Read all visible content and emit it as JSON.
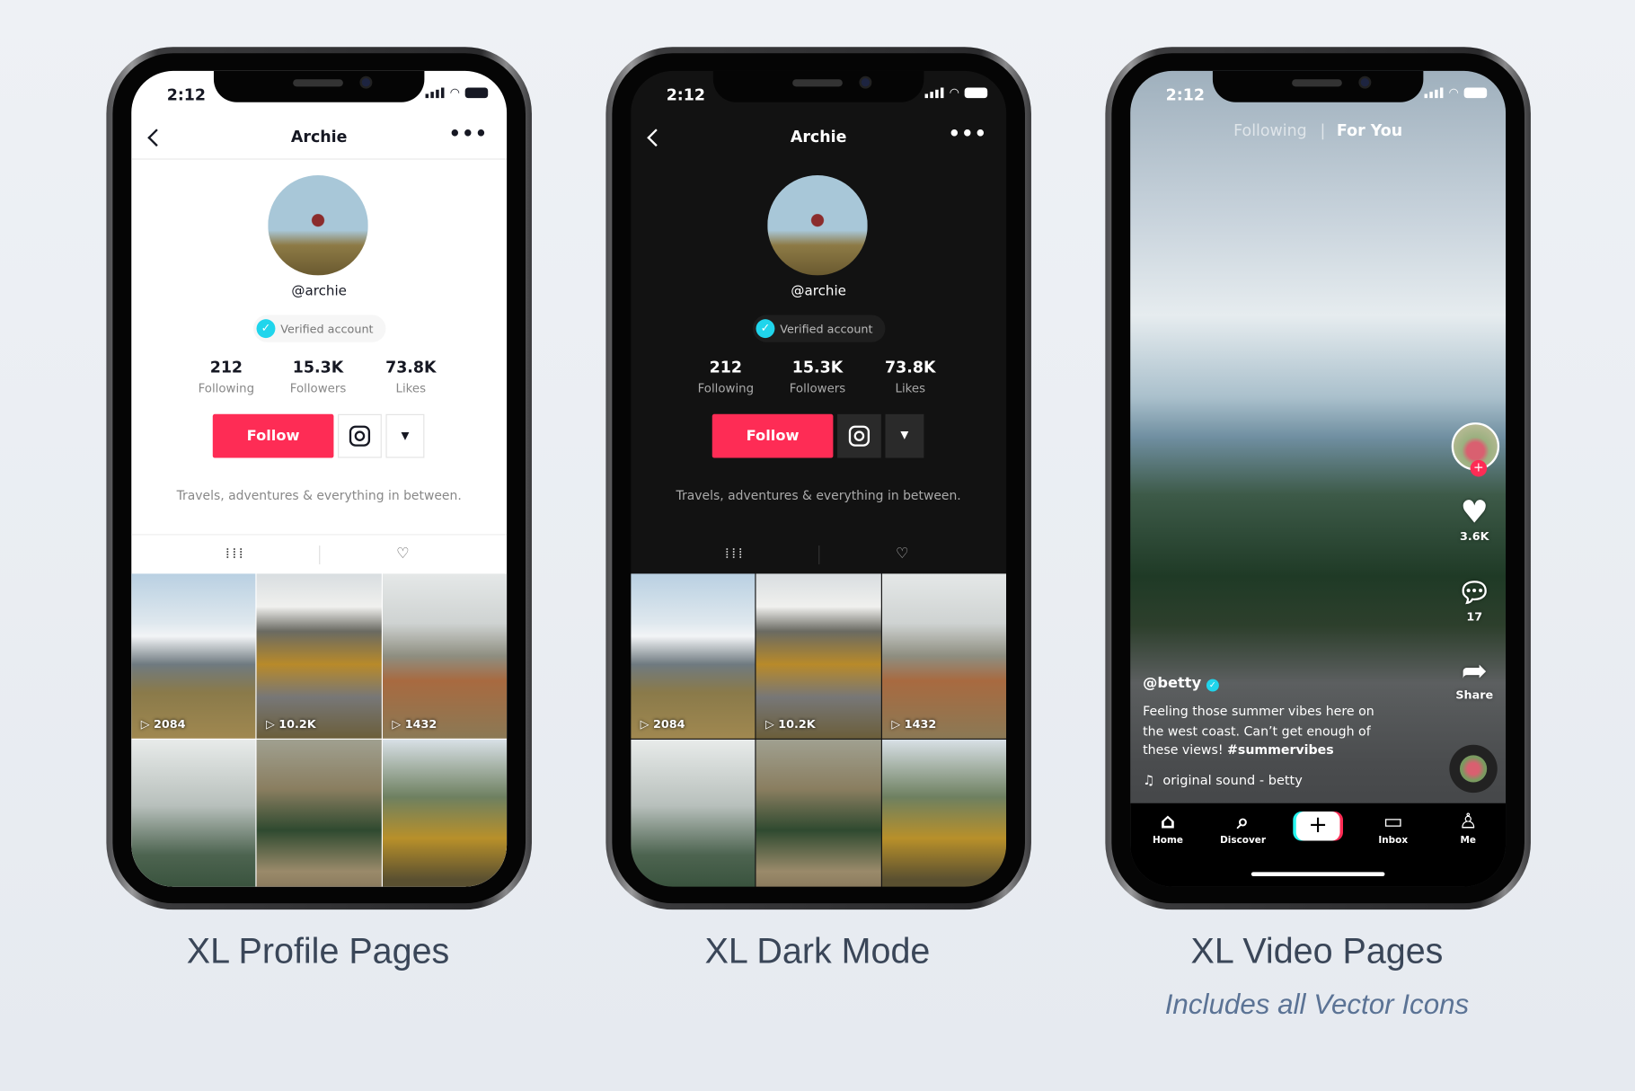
{
  "status": {
    "time": "2:12"
  },
  "profile": {
    "title": "Archie",
    "handle": "@archie",
    "verified_label": "Verified account",
    "stats": [
      {
        "value": "212",
        "label": "Following"
      },
      {
        "value": "15.3K",
        "label": "Followers"
      },
      {
        "value": "73.8K",
        "label": "Likes"
      }
    ],
    "follow_label": "Follow",
    "bio": "Travels, adventures & everything in between.",
    "videos": [
      {
        "plays": "2084"
      },
      {
        "plays": "10.2K"
      },
      {
        "plays": "1432"
      },
      {
        "plays": ""
      },
      {
        "plays": ""
      },
      {
        "plays": ""
      }
    ]
  },
  "video": {
    "tabs": {
      "following": "Following",
      "for_you": "For You"
    },
    "likes": "3.6K",
    "comments": "17",
    "share_label": "Share",
    "author": "@betty",
    "caption": "Feeling those summer vibes here on the west coast. Can’t get enough of these views!",
    "hashtag": "#summervibes",
    "sound": "original sound - betty",
    "nav": {
      "home": "Home",
      "discover": "Discover",
      "inbox": "Inbox",
      "me": "Me"
    }
  },
  "captions": {
    "profile": "XL Profile Pages",
    "dark": "XL Dark Mode",
    "video": "XL Video Pages",
    "video_sub": "Includes all Vector Icons"
  },
  "colors": {
    "accent": "#fe2c55",
    "verified": "#20d5ec",
    "background": "#e9edf2"
  }
}
